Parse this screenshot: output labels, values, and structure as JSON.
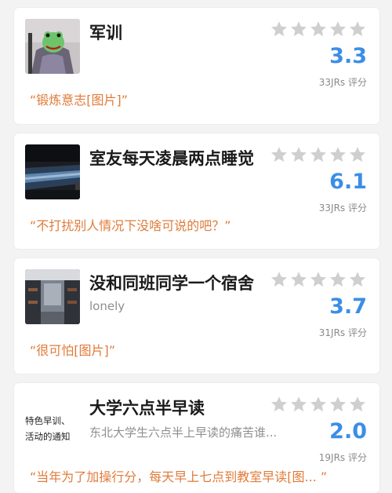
{
  "items": [
    {
      "title": "军训",
      "subtitle": "",
      "score": "3.3",
      "count": "33JRs 评分",
      "quote": "“锻炼意志[图片]”",
      "thumb_icon": "green-frog-mask-photo-icon"
    },
    {
      "title": "室友每天凌晨两点睡觉",
      "subtitle": "",
      "score": "6.1",
      "count": "33JRs 评分",
      "quote": "“不打扰别人情况下没啥可说的吧？”",
      "thumb_icon": "dark-window-night-photo-icon"
    },
    {
      "title": "没和同班同学一个宿舍",
      "subtitle": "lonely",
      "score": "3.7",
      "count": "31JRs 评分",
      "quote": "“很可怕[图片]”",
      "thumb_icon": "dormitory-corridor-photo-icon"
    },
    {
      "title": "大学六点半早读",
      "subtitle": "东北大学生六点半上早读的痛苦谁...",
      "score": "2.0",
      "count": "19JRs 评分",
      "quote": "“当年为了加操行分，每天早上七点到教室早读[图... ”",
      "thumb_icon": "notice-text-snippet-icon",
      "thumb_text": [
        "特色早训、",
        "活动的通知"
      ]
    }
  ],
  "colors": {
    "score": "#3b8ee6",
    "quote": "#e07b3a",
    "star_empty": "#cfcfcf"
  }
}
